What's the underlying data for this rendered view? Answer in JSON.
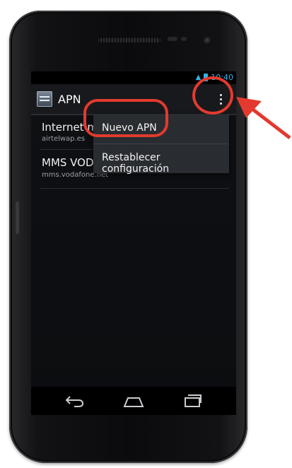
{
  "status_bar": {
    "time": "10:40",
    "signal_glyph": "▲",
    "icons": [
      "signal-icon",
      "battery-icon"
    ]
  },
  "action_bar": {
    "title": "APN",
    "icon": "apn-settings-icon",
    "overflow_icon": "overflow-menu-icon"
  },
  "apn_list": [
    {
      "name": "Internet m",
      "apn": "airtelwap.es"
    },
    {
      "name": "MMS VODA",
      "apn": "mms.vodafone.net"
    }
  ],
  "overflow_menu": {
    "items": [
      {
        "label": "Nuevo APN"
      },
      {
        "label": "Restablecer configuración"
      }
    ]
  },
  "nav_bar": {
    "icons": [
      "back-icon",
      "home-icon",
      "recent-apps-icon"
    ]
  },
  "colors": {
    "accent": "#33b5e5",
    "highlight": "#e23a2f",
    "screen_bg": "#0c0e11"
  }
}
